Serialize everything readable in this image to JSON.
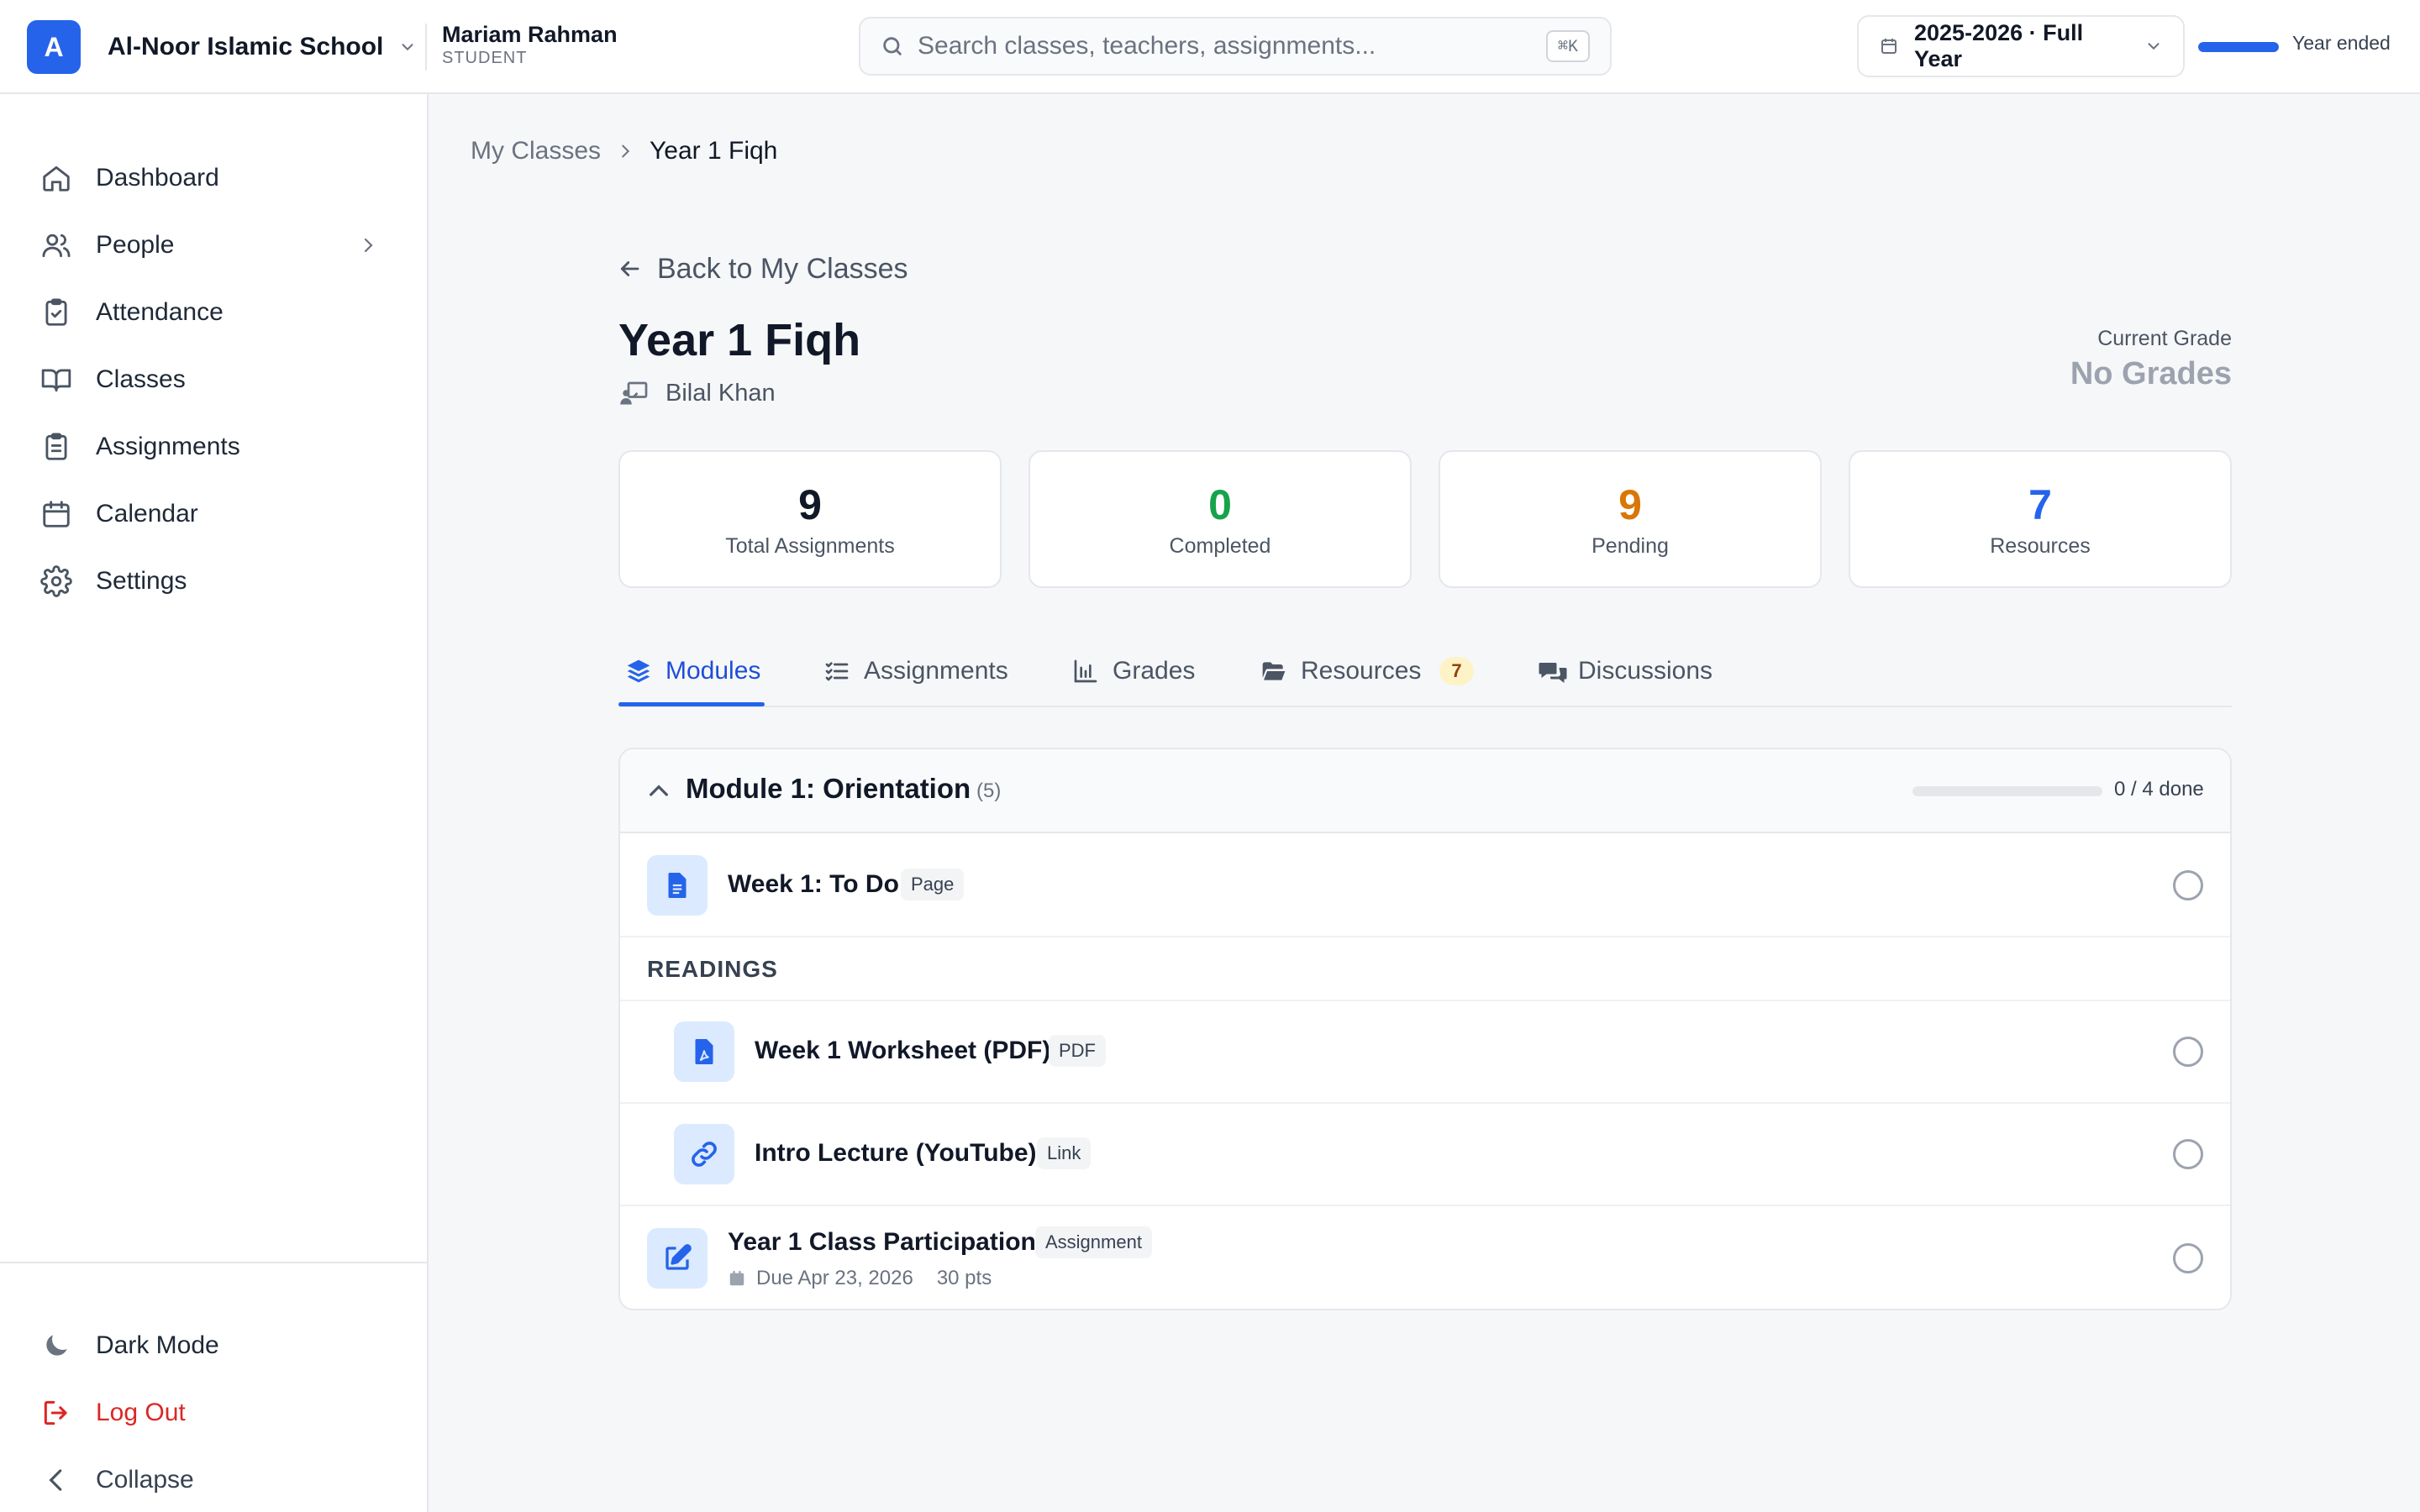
{
  "header": {
    "org_initial": "A",
    "org_name": "Al-Noor Islamic School",
    "user_name": "Mariam Rahman",
    "user_role": "STUDENT",
    "search_placeholder": "Search classes, teachers, assignments...",
    "search_shortcut": "⌘K",
    "year_label": "2025-2026 · Full Year",
    "year_progress": 1.0,
    "year_status": "Year ended"
  },
  "sidebar": {
    "items": [
      {
        "label": "Dashboard",
        "icon": "home-icon"
      },
      {
        "label": "People",
        "icon": "users-icon"
      },
      {
        "label": "Attendance",
        "icon": "clipboard-check-icon"
      },
      {
        "label": "Classes",
        "icon": "book-open-icon"
      },
      {
        "label": "Assignments",
        "icon": "clipboard-list-icon"
      },
      {
        "label": "Calendar",
        "icon": "calendar-icon"
      },
      {
        "label": "Settings",
        "icon": "gear-icon"
      }
    ],
    "bottom": {
      "dark_mode": "Dark Mode",
      "logout": "Log Out",
      "collapse": "Collapse"
    }
  },
  "breadcrumb": {
    "parent": "My Classes",
    "current": "Year 1 Fiqh"
  },
  "class": {
    "back_label": "Back to My Classes",
    "title": "Year 1 Fiqh",
    "teacher": "Bilal Khan",
    "grade_caption": "Current Grade",
    "grade_value": "No Grades"
  },
  "stats": [
    {
      "value": "9",
      "label": "Total Assignments",
      "color": "#111827"
    },
    {
      "value": "0",
      "label": "Completed",
      "color": "#16a34a"
    },
    {
      "value": "9",
      "label": "Pending",
      "color": "#d97706"
    },
    {
      "value": "7",
      "label": "Resources",
      "color": "#2563eb"
    }
  ],
  "tabs": [
    {
      "label": "Modules",
      "icon": "layers-icon",
      "active": true
    },
    {
      "label": "Assignments",
      "icon": "list-check-icon"
    },
    {
      "label": "Grades",
      "icon": "bar-chart-icon"
    },
    {
      "label": "Resources",
      "icon": "folder-open-icon",
      "badge": "7"
    },
    {
      "label": "Discussions",
      "icon": "comments-icon"
    }
  ],
  "module": {
    "title": "Module 1: Orientation",
    "count": "(5)",
    "progress": 0.0,
    "done_label": "0 / 4 done",
    "section_label": "READINGS",
    "items": [
      {
        "title": "Week 1: To Do",
        "badge": "Page",
        "icon": "file-text-icon"
      },
      {
        "title": "Week 1 Worksheet (PDF)",
        "badge": "PDF",
        "icon": "file-pdf-icon"
      },
      {
        "title": "Intro Lecture (YouTube)",
        "badge": "Link",
        "icon": "link-icon"
      },
      {
        "title": "Year 1 Class Participation",
        "badge": "Assignment",
        "icon": "edit-icon",
        "due": "Due Apr 23, 2026",
        "points": "30 pts"
      }
    ]
  }
}
